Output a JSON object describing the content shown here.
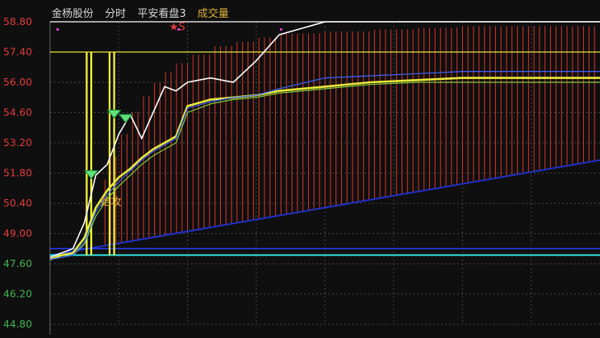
{
  "header": {
    "stock_name": "金杨股份",
    "period": "分时",
    "indicator": "平安看盘3",
    "volume_label": "成交量"
  },
  "colors": {
    "background": "#0f0f0f",
    "axis_up": "#e23b3b",
    "axis_down": "#3fb34f",
    "price_line": "#ffffff",
    "avg_line": "#e8e83a",
    "ma_green": "#7fd23a",
    "ma_blue": "#3a64ff",
    "cyan": "#2fe0e0",
    "volume_bar": "#d8362a",
    "signal": "#ffff33",
    "grid": "#444444"
  },
  "chart_data": {
    "type": "line",
    "ylim": [
      44.8,
      58.8
    ],
    "y_ticks": [
      "58.80",
      "57.40",
      "56.00",
      "54.60",
      "53.20",
      "51.80",
      "50.40",
      "49.00",
      "47.60",
      "46.20",
      "44.80"
    ],
    "prev_close": 48.0,
    "x": [
      0,
      5,
      10,
      15,
      20,
      25,
      30,
      35,
      40,
      45,
      50,
      55,
      60,
      70,
      80,
      90,
      100,
      120,
      140,
      160,
      180,
      200,
      220,
      240
    ],
    "series": [
      {
        "key": "price",
        "values": [
          47.9,
          48.1,
          48.3,
          49.5,
          51.7,
          52.2,
          53.6,
          54.5,
          53.4,
          54.6,
          55.8,
          55.6,
          56.0,
          56.2,
          56.0,
          57.0,
          58.2,
          58.8,
          58.8,
          58.8,
          58.8,
          58.8,
          58.8,
          58.8
        ]
      },
      {
        "key": "avg",
        "values": [
          47.8,
          48.0,
          48.1,
          48.8,
          50.2,
          51.0,
          51.6,
          52.0,
          52.5,
          52.9,
          53.2,
          53.5,
          54.9,
          55.2,
          55.3,
          55.4,
          55.6,
          55.8,
          56.0,
          56.1,
          56.2,
          56.2,
          56.2,
          56.2
        ]
      },
      {
        "key": "ma_green",
        "values": [
          47.8,
          47.9,
          48.0,
          48.5,
          49.8,
          50.6,
          51.2,
          51.7,
          52.2,
          52.6,
          52.9,
          53.2,
          54.6,
          55.0,
          55.2,
          55.3,
          55.5,
          55.7,
          55.9,
          56.0,
          56.0,
          56.0,
          56.0,
          56.0
        ]
      },
      {
        "key": "ma_blue",
        "values": [
          47.8,
          47.9,
          48.0,
          48.6,
          50.0,
          50.8,
          51.4,
          51.9,
          52.4,
          52.8,
          53.1,
          53.4,
          54.8,
          55.1,
          55.3,
          55.4,
          55.7,
          56.2,
          56.3,
          56.4,
          56.5,
          56.5,
          56.5,
          56.5
        ]
      }
    ],
    "level_lines": [
      57.4,
      48.3,
      48.0
    ],
    "volume_envelope": [
      0,
      0,
      0,
      0,
      0.2,
      0.3,
      0.4,
      0.5,
      0.6,
      0.67,
      0.73,
      0.78,
      0.82,
      0.86,
      0.9,
      0.92,
      0.94,
      0.96,
      0.97,
      0.98,
      0.99,
      1,
      1,
      1
    ],
    "volume_top_price": 58.6,
    "annotations": [
      {
        "text": "★S",
        "x": 52,
        "y": 58.6,
        "color": "#e23b3b"
      },
      {
        "text": "始攻",
        "x": 22,
        "y": 50.5,
        "color": "#e0b23a"
      }
    ],
    "signal_markers": [
      {
        "x": 18,
        "y": 51.8
      },
      {
        "x": 28,
        "y": 54.6
      },
      {
        "x": 33,
        "y": 54.4
      }
    ],
    "yellow_bars_x": [
      16,
      18,
      26,
      28
    ]
  }
}
